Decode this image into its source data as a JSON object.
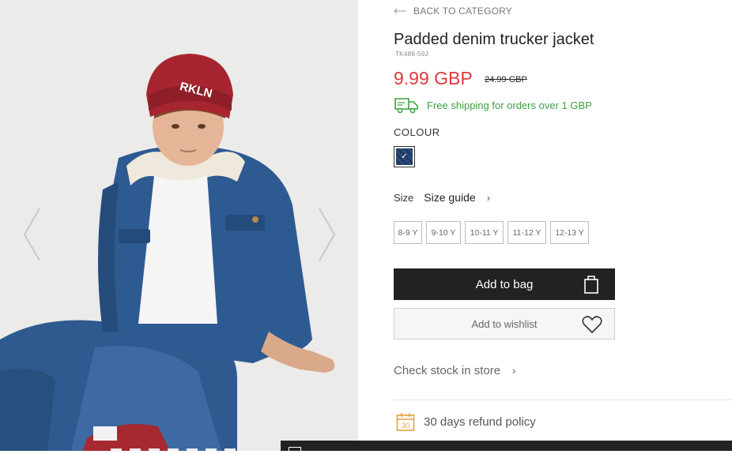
{
  "gallery": {
    "beanie_text": "RKLN",
    "icons": {
      "prev": "chevron-left-icon",
      "next": "chevron-right-icon"
    }
  },
  "nav": {
    "back_label": "BACK TO CATEGORY",
    "icon": "arrow-left-icon"
  },
  "product": {
    "title": "Padded denim trucker jacket",
    "sku": "TK486-59J",
    "price": "9.99 GBP",
    "old_price": "24.99 GBP",
    "price_color": "#e0383b"
  },
  "shipping": {
    "text": "Free shipping for orders over 1 GBP",
    "icon": "truck-icon",
    "color": "#3fa142"
  },
  "colour": {
    "label": "COLOUR",
    "selected_swatch": "denim-blue",
    "check": "✓"
  },
  "size": {
    "label": "Size",
    "guide_label": "Size guide",
    "guide_chevron": "›",
    "options": [
      "8-9 Y",
      "9-10 Y",
      "10-11 Y",
      "11-12 Y",
      "12-13 Y"
    ]
  },
  "actions": {
    "add_to_bag": "Add to bag",
    "add_to_bag_icon": "shopping-bag-icon",
    "add_to_wishlist": "Add to wishlist",
    "wishlist_icon": "heart-icon"
  },
  "stock": {
    "label": "Check stock in store",
    "chevron": "›"
  },
  "refund": {
    "text": "30 days refund policy",
    "icon_number": "30",
    "icon": "calendar-icon"
  }
}
